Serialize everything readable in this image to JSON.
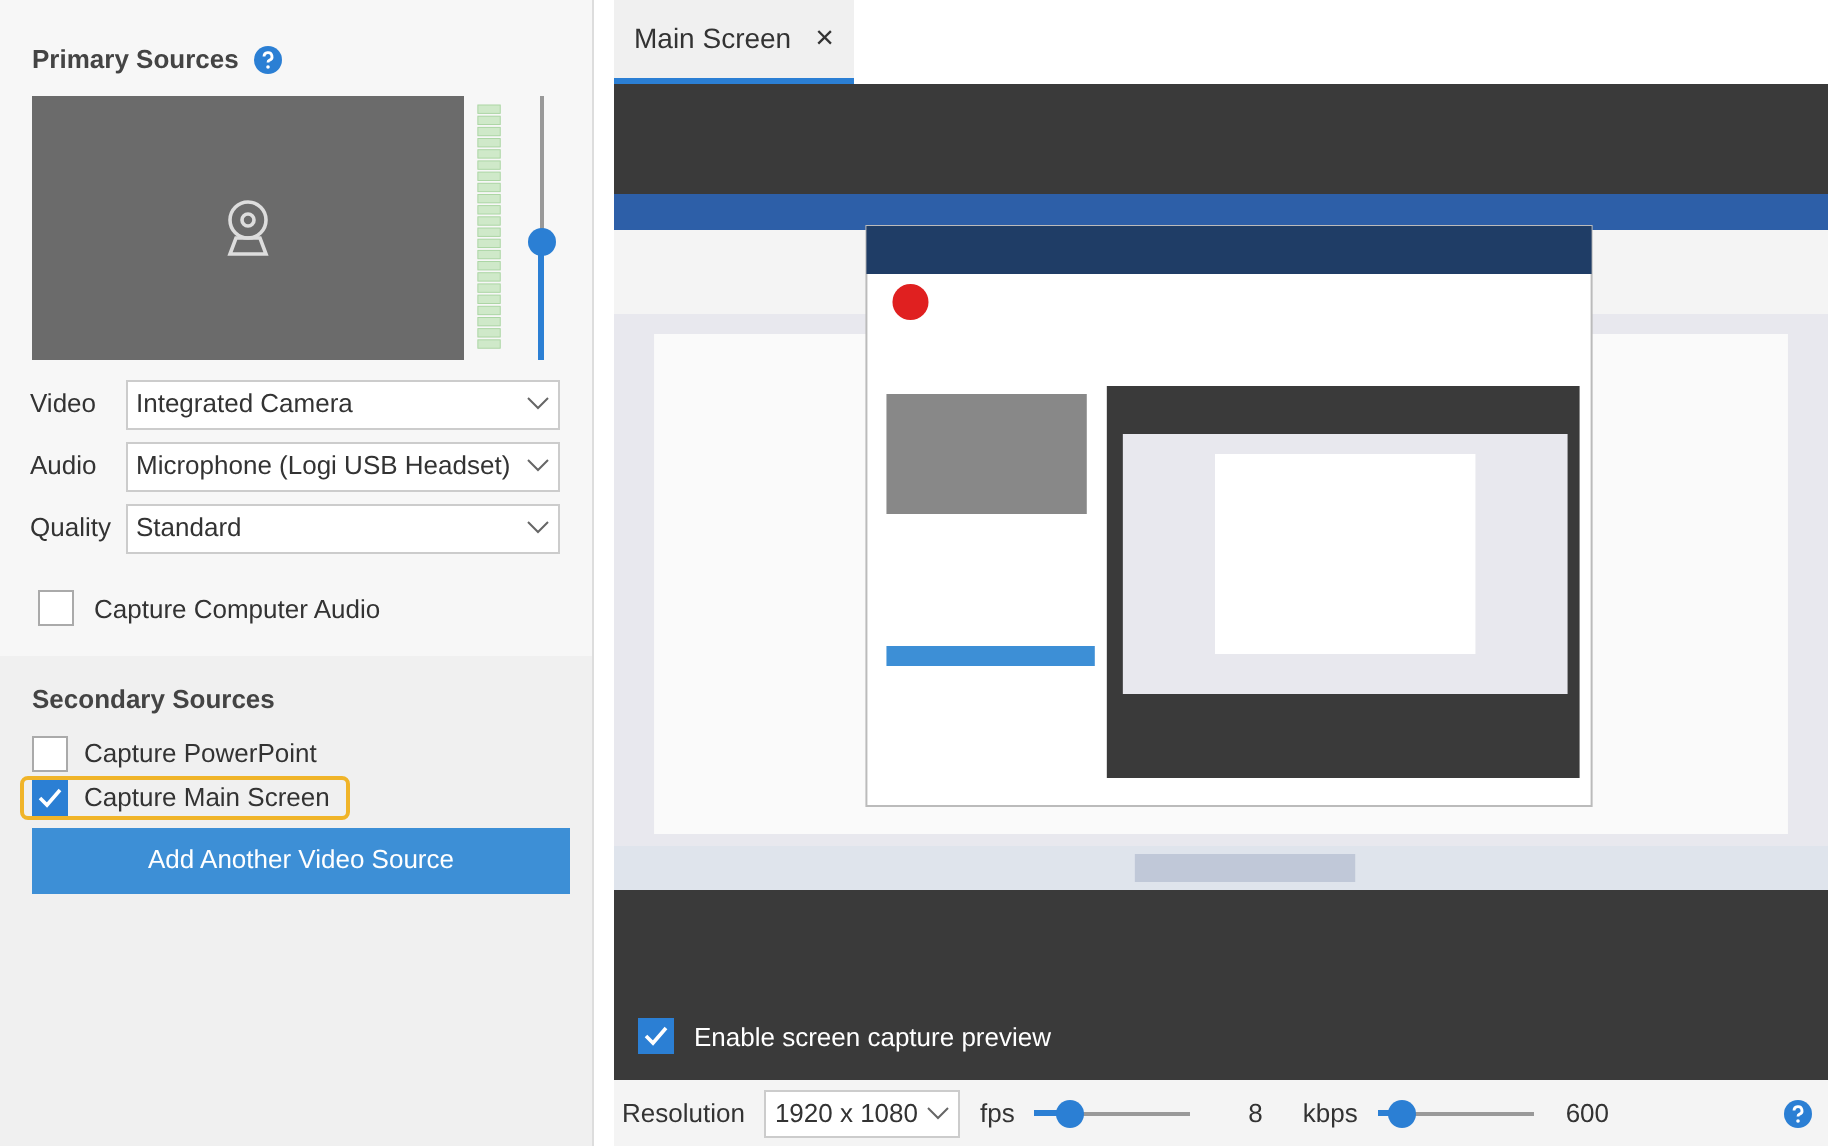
{
  "primary": {
    "title": "Primary Sources",
    "volume": {
      "level": 0.44
    },
    "fields": [
      {
        "label": "Video",
        "value": "Integrated Camera"
      },
      {
        "label": "Audio",
        "value": "Microphone (Logi USB Headset)"
      },
      {
        "label": "Quality",
        "value": "Standard"
      }
    ],
    "capture_audio": {
      "label": "Capture Computer Audio",
      "checked": false
    }
  },
  "secondary": {
    "title": "Secondary Sources",
    "options": [
      {
        "label": "Capture PowerPoint",
        "checked": false,
        "selected": false
      },
      {
        "label": "Capture Main Screen",
        "checked": true,
        "selected": true
      }
    ],
    "add_button": "Add Another Video Source"
  },
  "tabs": [
    {
      "label": "Main Screen",
      "close": "×",
      "selected": true
    }
  ],
  "enable_preview": {
    "label": "Enable screen capture preview",
    "checked": true
  },
  "bottom_bar": {
    "resolution_label": "Resolution",
    "resolution": "1920 x 1080",
    "fps": {
      "label": "fps",
      "level": 0.22,
      "value": "8"
    },
    "kbps": {
      "label": "kbps",
      "level": 0.15,
      "value": "600"
    }
  }
}
